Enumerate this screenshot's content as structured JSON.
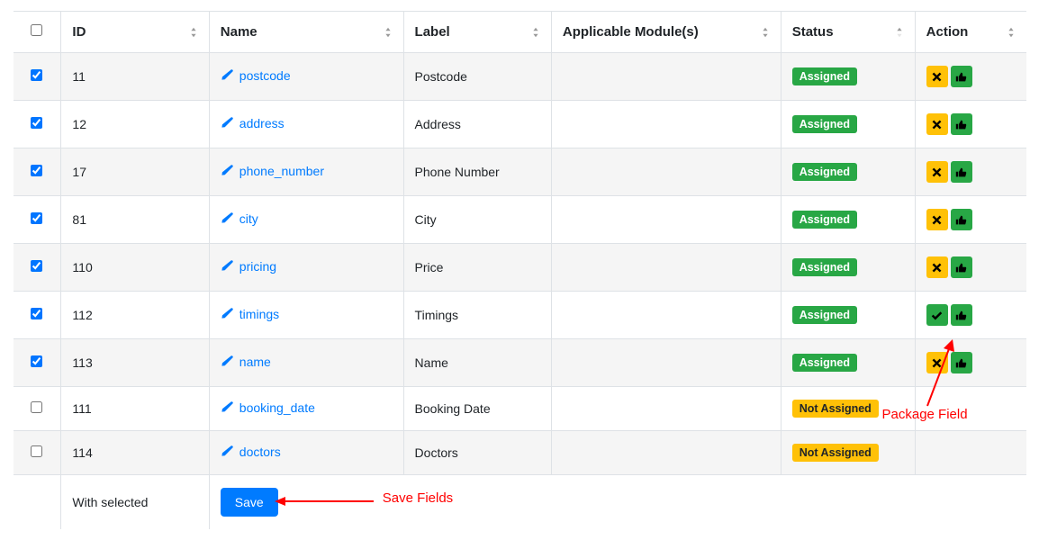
{
  "headers": {
    "id": "ID",
    "name": "Name",
    "label": "Label",
    "module": "Applicable Module(s)",
    "status": "Status",
    "action": "Action"
  },
  "rows": [
    {
      "checked": true,
      "id": "11",
      "name": "postcode",
      "label": "Postcode",
      "module": "",
      "status": "Assigned",
      "status_kind": "green",
      "act1": "x",
      "has_actions": true
    },
    {
      "checked": true,
      "id": "12",
      "name": "address",
      "label": "Address",
      "module": "",
      "status": "Assigned",
      "status_kind": "green",
      "act1": "x",
      "has_actions": true
    },
    {
      "checked": true,
      "id": "17",
      "name": "phone_number",
      "label": "Phone Number",
      "module": "",
      "status": "Assigned",
      "status_kind": "green",
      "act1": "x",
      "has_actions": true
    },
    {
      "checked": true,
      "id": "81",
      "name": "city",
      "label": "City",
      "module": "",
      "status": "Assigned",
      "status_kind": "green",
      "act1": "x",
      "has_actions": true
    },
    {
      "checked": true,
      "id": "110",
      "name": "pricing",
      "label": "Price",
      "module": "",
      "status": "Assigned",
      "status_kind": "green",
      "act1": "x",
      "has_actions": true
    },
    {
      "checked": true,
      "id": "112",
      "name": "timings",
      "label": "Timings",
      "module": "",
      "status": "Assigned",
      "status_kind": "green",
      "act1": "ck",
      "has_actions": true
    },
    {
      "checked": true,
      "id": "113",
      "name": "name",
      "label": "Name",
      "module": "",
      "status": "Assigned",
      "status_kind": "green",
      "act1": "x",
      "has_actions": true
    },
    {
      "checked": false,
      "id": "111",
      "name": "booking_date",
      "label": "Booking Date",
      "module": "",
      "status": "Not Assigned",
      "status_kind": "warn",
      "act1": "",
      "has_actions": false
    },
    {
      "checked": false,
      "id": "114",
      "name": "doctors",
      "label": "Doctors",
      "module": "",
      "status": "Not Assigned",
      "status_kind": "warn",
      "act1": "",
      "has_actions": false
    }
  ],
  "footer": {
    "with_selected": "With selected",
    "save": "Save"
  },
  "annotations": {
    "package_field": "Package Field",
    "save_fields": "Save Fields"
  }
}
